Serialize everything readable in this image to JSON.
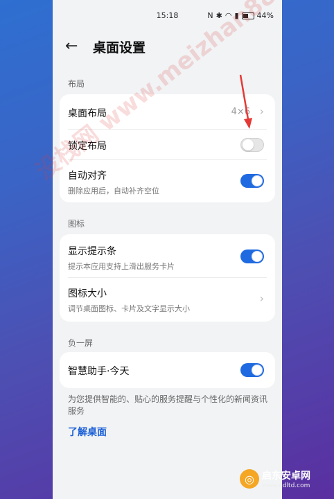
{
  "status": {
    "time": "15:18",
    "battery": "44%"
  },
  "header": {
    "title": "桌面设置"
  },
  "sections": {
    "layout": {
      "label": "布局",
      "desktop_layout": {
        "title": "桌面布局",
        "value": "4×6"
      },
      "lock_layout": {
        "title": "锁定布局",
        "on": false
      },
      "auto_align": {
        "title": "自动对齐",
        "subtitle": "删除应用后，自动补齐空位",
        "on": true
      }
    },
    "icons": {
      "label": "图标",
      "show_bar": {
        "title": "显示提示条",
        "subtitle": "提示本应用支持上滑出服务卡片",
        "on": true
      },
      "icon_size": {
        "title": "图标大小",
        "subtitle": "调节桌面图标、卡片及文字显示大小"
      }
    },
    "minus_one": {
      "label": "负一屏",
      "assistant": {
        "title": "智慧助手·今天",
        "on": true
      }
    }
  },
  "footnote": "为您提供智能的、贴心的服务提醒与个性化的新闻资讯服务",
  "learn_link": "了解桌面",
  "watermark": {
    "text": "没栈网 www.meizhan88.com",
    "logo_text": "启东安卓网",
    "logo_url": "www.qdltd.com"
  },
  "colors": {
    "accent": "#1f6ae0",
    "link": "#1b5fd6",
    "arrow": "#e53935"
  }
}
